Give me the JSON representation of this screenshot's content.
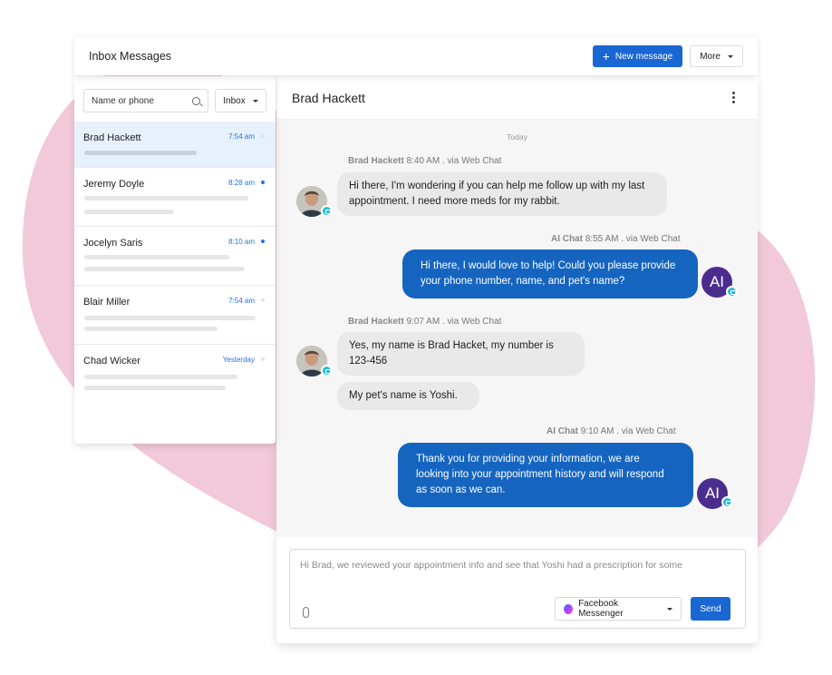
{
  "header": {
    "title": "Inbox Messages",
    "new_message_label": "New message",
    "more_label": "More"
  },
  "sidebar": {
    "search_placeholder": "Name or phone",
    "filter_label": "Inbox",
    "conversations": [
      {
        "name": "Brad Hackett",
        "time": "7:54 am",
        "unread": false,
        "selected": true
      },
      {
        "name": "Jeremy Doyle",
        "time": "8:28 am",
        "unread": true,
        "selected": false
      },
      {
        "name": "Jocelyn Saris",
        "time": "8:10 am",
        "unread": true,
        "selected": false
      },
      {
        "name": "Blair Miller",
        "time": "7:54 am",
        "unread": false,
        "selected": false
      },
      {
        "name": "Chad Wicker",
        "time": "Yesterday",
        "unread": false,
        "selected": false
      }
    ]
  },
  "chat": {
    "contact_name": "Brad Hackett",
    "day_label": "Today",
    "messages": [
      {
        "sender": "Brad Hackett",
        "meta": "8:40 AM . via Web Chat",
        "direction": "in",
        "texts": [
          "Hi there, I'm wondering if you can help me follow up with my last appointment. I need more meds for my rabbit."
        ]
      },
      {
        "sender": "AI Chat",
        "meta": "8:55 AM . via Web Chat",
        "direction": "out",
        "texts": [
          "Hi there, I would love to help! Could you please provide your phone number, name, and pet's name?"
        ]
      },
      {
        "sender": "Brad Hackett",
        "meta": "9:07 AM . via Web Chat",
        "direction": "in",
        "texts": [
          "Yes, my name is Brad Hacket, my number is 123-456",
          "My pet's name is Yoshi."
        ]
      },
      {
        "sender": "AI Chat",
        "meta": "9:10 AM . via Web Chat",
        "direction": "out",
        "texts": [
          "Thank you for providing your information, we are looking into your appointment history and will respond as soon as we can."
        ]
      }
    ],
    "ai_avatar_initials": "AI"
  },
  "compose": {
    "draft_text": "Hi Brad, we reviewed your appointment info and see that Yoshi had a prescription for some",
    "channel_label": "Facebook Messenger",
    "send_label": "Send"
  },
  "colors": {
    "accent": "#1967d2",
    "out_bubble": "#1565c0",
    "ai_avatar": "#4b2d8f",
    "badge": "#26bdd5",
    "background_blob": "#f2c9d9",
    "selected_row": "#e6f1fb"
  },
  "icons": [
    "plus-icon",
    "search-icon",
    "chevron-down-icon",
    "kebab-menu-icon",
    "web-chat-badge-icon",
    "paperclip-icon",
    "messenger-icon"
  ]
}
